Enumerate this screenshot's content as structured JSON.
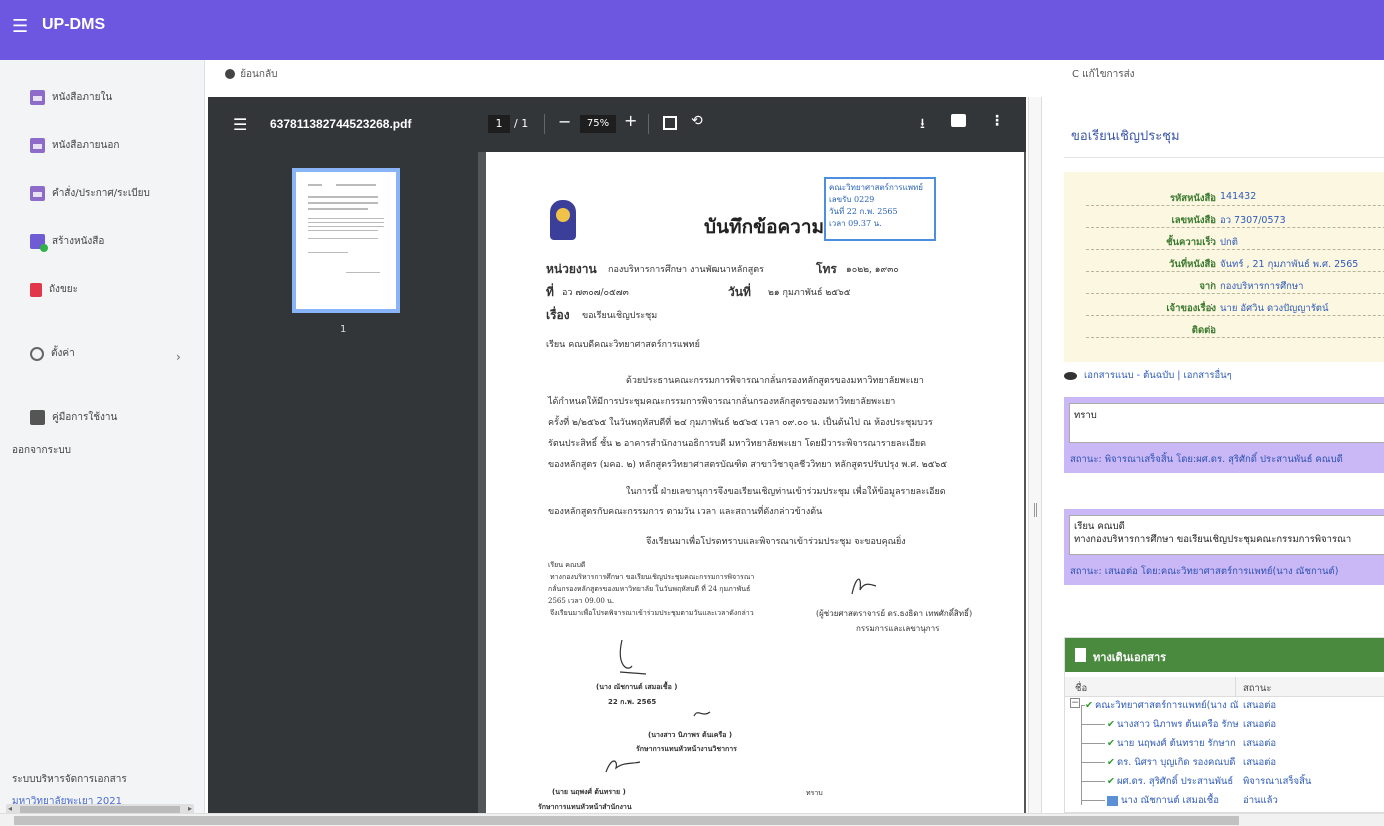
{
  "app": {
    "title": "UP-DMS",
    "menu_icon": "hamburger-icon"
  },
  "sidebar": {
    "items": [
      {
        "label": "หนังสือภายใน",
        "icon": "folder-icon"
      },
      {
        "label": "หนังสือภายนอก",
        "icon": "folder-icon"
      },
      {
        "label": "คำสั่ง/ประกาศ/ระเบียบ",
        "icon": "folder-icon"
      },
      {
        "label": "สร้างหนังสือ",
        "icon": "create-document-icon"
      },
      {
        "label": "ถังขยะ",
        "icon": "trash-icon"
      },
      {
        "label": "ตั้งค่า",
        "icon": "gear-icon"
      },
      {
        "label": "คู่มือการใช้งาน",
        "icon": "manual-icon"
      },
      {
        "label": "ออกจากระบบ"
      }
    ],
    "footer_title": "ระบบบริหารจัดการเอกสาร",
    "footer_org": "มหาวิทยาลัยพะเยา 2021"
  },
  "nav": {
    "back_label": "ย้อนกลับ",
    "edit_label": "แก้ไขการส่ง"
  },
  "viewer": {
    "filename": "637811382744523268.pdf",
    "page_current": "1",
    "page_total": "/ 1",
    "zoom": "75%",
    "thumb_number": "1"
  },
  "memo": {
    "title": "บันทึกข้อความ",
    "stamp_lines": [
      "คณะวิทยาศาสตร์การแพทย์",
      "เลขรับ 0229",
      "วันที่ 22 ก.พ. 2565",
      "เวลา 09.37 น."
    ],
    "dept_label": "หน่วยงาน",
    "dept_value": "กองบริหารการศึกษา งานพัฒนาหลักสูตร",
    "tel_label": "โทร",
    "tel_value": "๑๐๒๒, ๑๙๓๐",
    "no_label": "ที่",
    "no_value": "อว ๗๓๐๗/๐๕๗๓",
    "date_label": "วันที่",
    "date_value": "๒๑ กุมภาพันธ์ ๒๕๖๕",
    "subject_label": "เรื่อง",
    "subject_value": "ขอเรียนเชิญประชุม",
    "to_line": "เรียน   คณบดีคณะวิทยาศาสตร์การแพทย์",
    "para1": [
      "ด้วยประธานคณะกรรมการพิจารณากลั่นกรองหลักสูตรของมหาวิทยาลัยพะเยา",
      "ได้กำหนดให้มีการประชุมคณะกรรมการพิจารณากลั่นกรองหลักสูตรของมหาวิทยาลัยพะเยา",
      "ครั้งที่ ๒/๒๕๖๕ ในวันพฤหัสบดีที่ ๒๔ กุมภาพันธ์ ๒๕๖๕ เวลา ๐๙.๐๐ น. เป็นต้นไป ณ ห้องประชุมบวร",
      "รัตนประสิทธิ์ ชั้น ๒ อาคารสำนักงานอธิการบดี มหาวิทยาลัยพะเยา โดยมีวาระพิจารณารายละเอียด",
      "ของหลักสูตร (มคอ. ๒) หลักสูตรวิทยาศาสตรบัณฑิต สาขาวิชาจุลชีววิทยา หลักสูตรปรับปรุง พ.ศ. ๒๕๖๕"
    ],
    "para2": [
      "ในการนี้ ฝ่ายเลขานุการจึงขอเรียนเชิญท่านเข้าร่วมประชุม เพื่อให้ข้อมูลรายละเอียด",
      "ของหลักสูตรกับคณะกรรมการ ตามวัน เวลา และสถานที่ดังกล่าวข้างต้น"
    ],
    "para3": "จึงเรียนมาเพื่อโปรดทราบและพิจารณาเข้าร่วมประชุม จะขอบคุณยิ่ง",
    "note_lines": [
      "เรียน คณบดี",
      "ทางกองบริหารการศึกษา ขอเรียนเชิญประชุมคณะกรรมการพิจารณา",
      "กลั่นกรองหลักสูตรของมหาวิทยาลัย ในวันพฤหัสบดี ที่ 24 กุมภาพันธ์",
      "2565 เวลา 09.00 น.",
      "จึงเรียนมาเพื่อโปรดพิจารณาเข้าร่วมประชุมตามวันและเวลาดังกล่าว"
    ],
    "signer_name": "(ผู้ช่วยศาสตราจารย์ ดร.ธงธิดา  เทพศักดิ์สิทธิ์)",
    "signer_title": "กรรมการและเลขานุการ",
    "note_signer1": "(นาง ณัชกานต์ เสมอเชื้อ )",
    "note_date1": "22 ก.พ. 2565",
    "note_signer2": "(นางสาว นิภาพร ต้นเครือ )",
    "note_title2": "รักษาการแทนหัวหน้างานวิชาการ",
    "note_signer3": "(นาย นฤพงศ์ ต้นทราย )",
    "note_title3": "รักษาการแทนหัวหน้าสำนักงาน",
    "note_ack": "ทราบ"
  },
  "detail": {
    "title": "ขอเรียนเชิญประชุม",
    "fields": [
      {
        "key": "รหัสหนังสือ",
        "value": "141432"
      },
      {
        "key": "เลขหนังสือ",
        "value": "อว 7307/0573"
      },
      {
        "key": "ชั้นความเร็ว",
        "value": "ปกติ"
      },
      {
        "key": "วันที่หนังสือ",
        "value": "จันทร์ , 21 กุมภาพันธ์ พ.ศ. 2565"
      },
      {
        "key": "จาก",
        "value": "กองบริหารการศึกษา"
      },
      {
        "key": "เจ้าของเรื่อง",
        "value": "นาย อัศวิน ดวงปัญญารัตน์"
      },
      {
        "key": "ติดต่อ",
        "value": ""
      }
    ],
    "attachments_label": "เอกสารแนบ - ต้นฉบับ | เอกสารอื่นๆ"
  },
  "comments": [
    {
      "text": "ทราบ",
      "status": "สถานะ: พิจารณาเสร็จสิ้น  โดย:ผศ.ดร. สุริศักดิ์ ประสานพันธ์ คณบดี"
    },
    {
      "text": "เรียน คณบดี",
      "text2": "ทางกองบริหารการศึกษา ขอเรียนเชิญประชุมคณะกรรมการพิจารณา",
      "status": "สถานะ: เสนอต่อ  โดย:คณะวิทยาศาสตร์การแพทย์(นาง ณัชกานต์)"
    }
  ],
  "path": {
    "title": "ทางเดินเอกสาร",
    "col_name": "ชื่อ",
    "col_status": "สถานะ",
    "rows": [
      {
        "name": "คณะวิทยาศาสตร์การแพทย์(นาง ณั",
        "status": "เสนอต่อ"
      },
      {
        "name": "นางสาว นิภาพร ต้นเครือ รักษ",
        "status": "เสนอต่อ"
      },
      {
        "name": "นาย นฤพงศ์ ต้นทราย รักษาก",
        "status": "เสนอต่อ"
      },
      {
        "name": "ดร. นิศรา บุญเกิด รองคณบดี",
        "status": "เสนอต่อ"
      },
      {
        "name": "ผศ.ดร. สุริศักดิ์ ประสานพันธ์",
        "status": "พิจารณาเสร็จสิ้น"
      },
      {
        "name": "นาง ณัชกานต์ เสมอเชื้อ",
        "status": "อ่านแล้ว"
      }
    ]
  }
}
